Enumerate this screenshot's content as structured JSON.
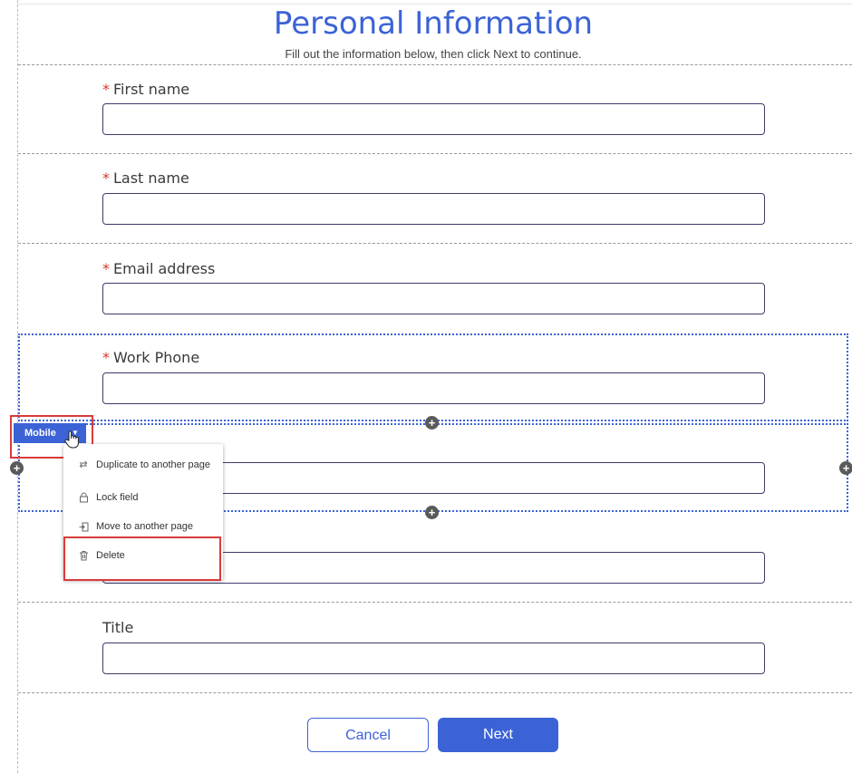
{
  "form": {
    "title": "Personal Information",
    "subtitle": "Fill out the information below, then click Next to continue.",
    "required_marker": "*",
    "fields": [
      {
        "label": "First name",
        "required": true,
        "value": ""
      },
      {
        "label": "Last name",
        "required": true,
        "value": ""
      },
      {
        "label": "Email address",
        "required": true,
        "value": ""
      },
      {
        "label": "Work Phone",
        "required": true,
        "value": ""
      },
      {
        "label": "Mobile",
        "required": false,
        "value": ""
      },
      {
        "label": "",
        "required": false,
        "value": ""
      },
      {
        "label": "Title",
        "required": false,
        "value": ""
      }
    ]
  },
  "field_tag": {
    "label": "Mobile"
  },
  "context_menu": {
    "items": [
      {
        "label": "Duplicate to another page",
        "icon": "duplicate-icon"
      },
      {
        "label": "Lock field",
        "icon": "lock-icon"
      },
      {
        "label": "Move to another page",
        "icon": "move-icon"
      },
      {
        "label": "Delete",
        "icon": "trash-icon"
      }
    ]
  },
  "buttons": {
    "cancel": "Cancel",
    "next": "Next"
  },
  "colors": {
    "accent": "#3b63d6",
    "required": "#d9362a",
    "highlight": "#d93b3b"
  }
}
